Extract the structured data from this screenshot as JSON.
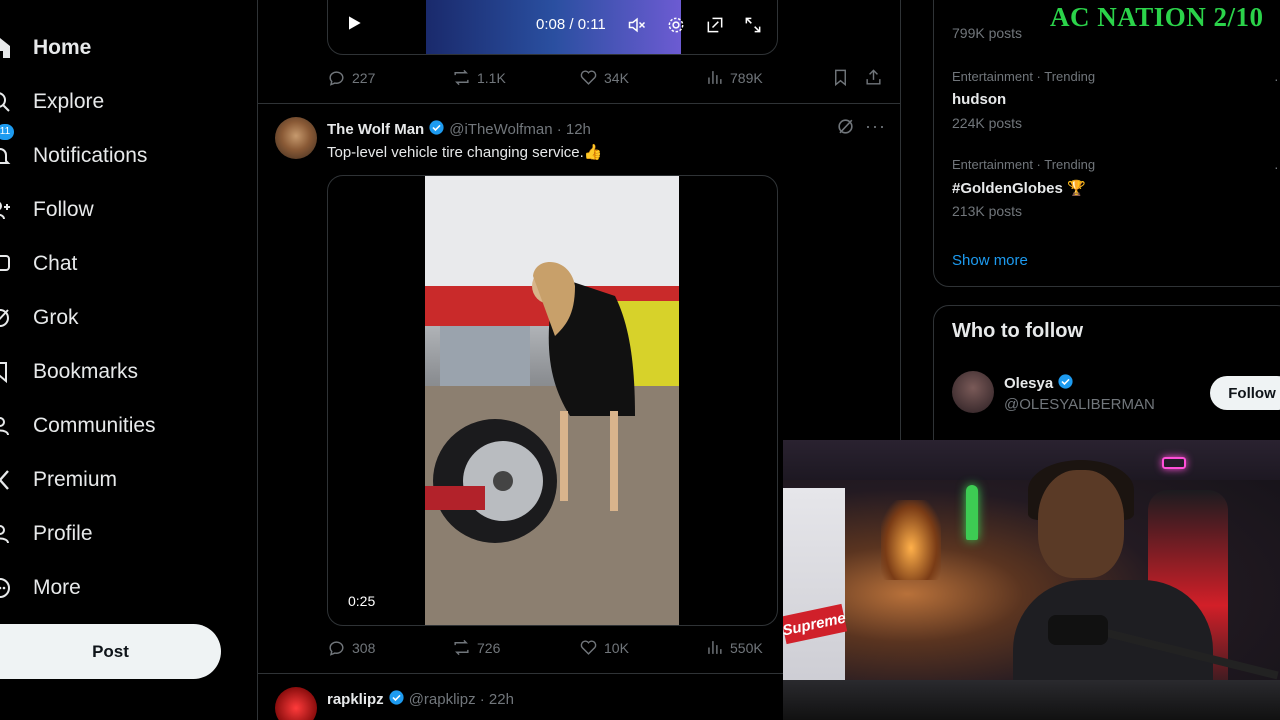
{
  "sidebar": {
    "items": [
      {
        "label": "Home",
        "icon": "home-icon",
        "active": true
      },
      {
        "label": "Explore",
        "icon": "search-icon"
      },
      {
        "label": "Notifications",
        "icon": "bell-icon",
        "badge": "11"
      },
      {
        "label": "Follow",
        "icon": "follow-icon"
      },
      {
        "label": "Chat",
        "icon": "chat-icon"
      },
      {
        "label": "Grok",
        "icon": "grok-icon"
      },
      {
        "label": "Bookmarks",
        "icon": "bookmark-icon"
      },
      {
        "label": "Communities",
        "icon": "communities-icon"
      },
      {
        "label": "Premium",
        "icon": "x-logo-icon"
      },
      {
        "label": "Profile",
        "icon": "profile-icon"
      },
      {
        "label": "More",
        "icon": "more-circle-icon"
      }
    ],
    "post_label": "Post"
  },
  "feed": {
    "top_video": {
      "time": "0:08 / 0:11",
      "progress_fraction": 0.73
    },
    "top_actions": {
      "replies": "227",
      "reposts": "1.1K",
      "likes": "34K",
      "views": "789K"
    },
    "tweet": {
      "name": "The Wolf Man",
      "handle": "@iTheWolfman · 12h",
      "text": "Top-level vehicle tire changing service.👍",
      "video_duration": "0:25",
      "actions": {
        "replies": "308",
        "reposts": "726",
        "likes": "10K",
        "views": "550K"
      }
    },
    "next_tweet": {
      "name": "rapklipz",
      "handle": "@rapklipz · 22h"
    }
  },
  "right": {
    "trends": [
      {
        "meta": "",
        "name": "",
        "count": "799K posts"
      },
      {
        "meta": "Entertainment · Trending",
        "name": "hudson",
        "count": "224K posts"
      },
      {
        "meta": "Entertainment · Trending",
        "name": "#GoldenGlobes 🏆",
        "count": "213K posts"
      }
    ],
    "show_more": "Show more",
    "who_to_follow": {
      "title": "Who to follow",
      "name": "Olesya",
      "handle": "@OLESYALIBERMAN",
      "follow_label": "Follow"
    }
  },
  "overlay": {
    "title": "AC NATION 2/10",
    "color": "#2bd34a"
  },
  "webcam": {
    "sign_text": "Supreme"
  },
  "colors": {
    "accent": "#1d9bf0",
    "text_primary": "#e7e9ea",
    "text_secondary": "#71767b",
    "border": "#2f3336"
  }
}
